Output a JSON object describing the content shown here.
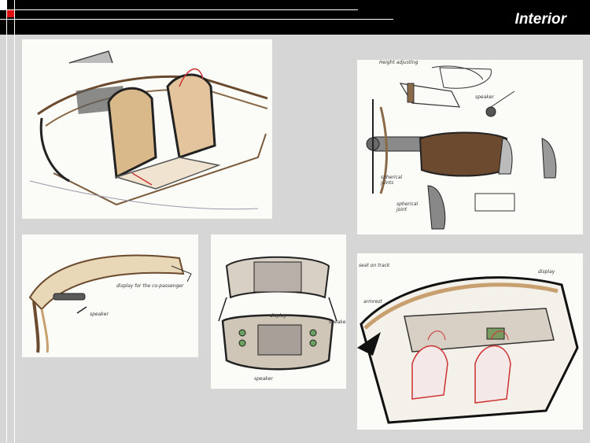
{
  "header": {
    "title": "Interior",
    "accent_color": "#e01010",
    "bar_color": "#000000"
  },
  "panels": {
    "top_right_notes": [
      "Height adjusting",
      "speaker",
      "spherical joints",
      "spherical joint"
    ],
    "bottom_left_notes": [
      "display for the co-passenger",
      "speaker"
    ],
    "bottom_center_notes": [
      "speaker",
      "speaker",
      "display"
    ],
    "bottom_right_notes": [
      "seat on track",
      "display",
      "armrest"
    ]
  }
}
